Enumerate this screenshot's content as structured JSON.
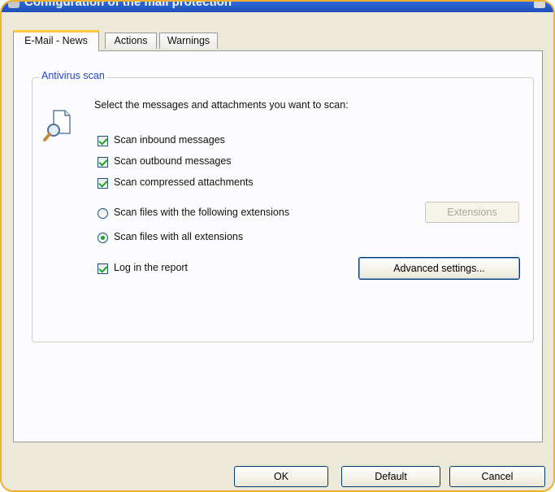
{
  "window": {
    "title": "Configuration of the mail protection",
    "icon": "app-icon",
    "accent_color": "#f0b030"
  },
  "tabs": [
    {
      "label": "E-Mail - News",
      "active": true
    },
    {
      "label": "Actions",
      "active": false
    },
    {
      "label": "Warnings",
      "active": false
    }
  ],
  "antivirus_scan": {
    "group_label": "Antivirus scan",
    "icon": "magnifier-document-icon",
    "instruction": "Select the messages and attachments you want to scan:",
    "checkboxes": [
      {
        "label": "Scan inbound messages",
        "checked": true
      },
      {
        "label": "Scan outbound messages",
        "checked": true
      },
      {
        "label": "Scan compressed attachments",
        "checked": true
      }
    ],
    "radios": [
      {
        "label": "Scan files with the following extensions",
        "selected": false
      },
      {
        "label": "Scan files with all extensions",
        "selected": true
      }
    ],
    "extensions_button": {
      "label": "Extensions",
      "enabled": false
    },
    "log_checkbox": {
      "label": "Log in the report",
      "checked": true
    },
    "advanced_button": {
      "label": "Advanced settings..."
    }
  },
  "footer": {
    "ok_label": "OK",
    "default_label": "Default",
    "cancel_label": "Cancel"
  }
}
